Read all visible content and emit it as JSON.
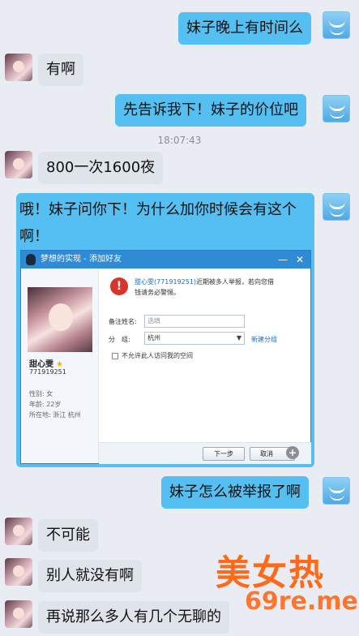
{
  "messages": [
    {
      "side": "out",
      "text": "妹子晚上有时间么"
    },
    {
      "side": "in",
      "text": "有啊"
    },
    {
      "side": "out",
      "text": "先告诉我下！妹子的价位吧"
    },
    {
      "side": "in",
      "text": "800一次1600夜"
    },
    {
      "side": "out",
      "text": "哦！妹子问你下！为什么加你时候会有这个啊！"
    },
    {
      "side": "out",
      "text": "妹子怎么被举报了啊"
    },
    {
      "side": "in",
      "text": "不可能"
    },
    {
      "side": "in",
      "text": "别人就没有啊"
    },
    {
      "side": "in",
      "text": "再说那么多人有几个无聊的"
    }
  ],
  "timestamp": "18:07:43",
  "dialog": {
    "title": "梦想的实现 - 添加好友",
    "minimize": "—",
    "close": "✕",
    "profile_name": "甜心雯",
    "profile_star": "★",
    "profile_id": "771919251",
    "gender": "性别: 女",
    "age": "年龄: 22岁",
    "location": "所在地: 浙江 杭州",
    "warning_name": "甜心雯(771919251)",
    "warning_rest": "近期被多人举报，若向您借钱请务必警惕。",
    "remark_label": "备注姓名:",
    "remark_placeholder": "选填",
    "group_label": "分　组:",
    "group_value": "杭州",
    "new_group": "新建分组",
    "checkbox_label": "不允许此人访问我的空间",
    "next_button": "下一步",
    "cancel_button": "取消"
  },
  "watermark": {
    "line1": "美女热",
    "line2": "69re.me"
  },
  "icons": {
    "warning": "warning-icon",
    "qq": "qq-penguin-icon",
    "user_avatar": "girl-avatar",
    "self_avatar": "smiley-avatar"
  },
  "colors": {
    "outgoing_bubble": "#55bff2",
    "incoming_bubble": "#dfe3ea",
    "background": "#e9edf3",
    "dialog_title": "#2f8bd6",
    "watermark": "#ff6a1a"
  }
}
